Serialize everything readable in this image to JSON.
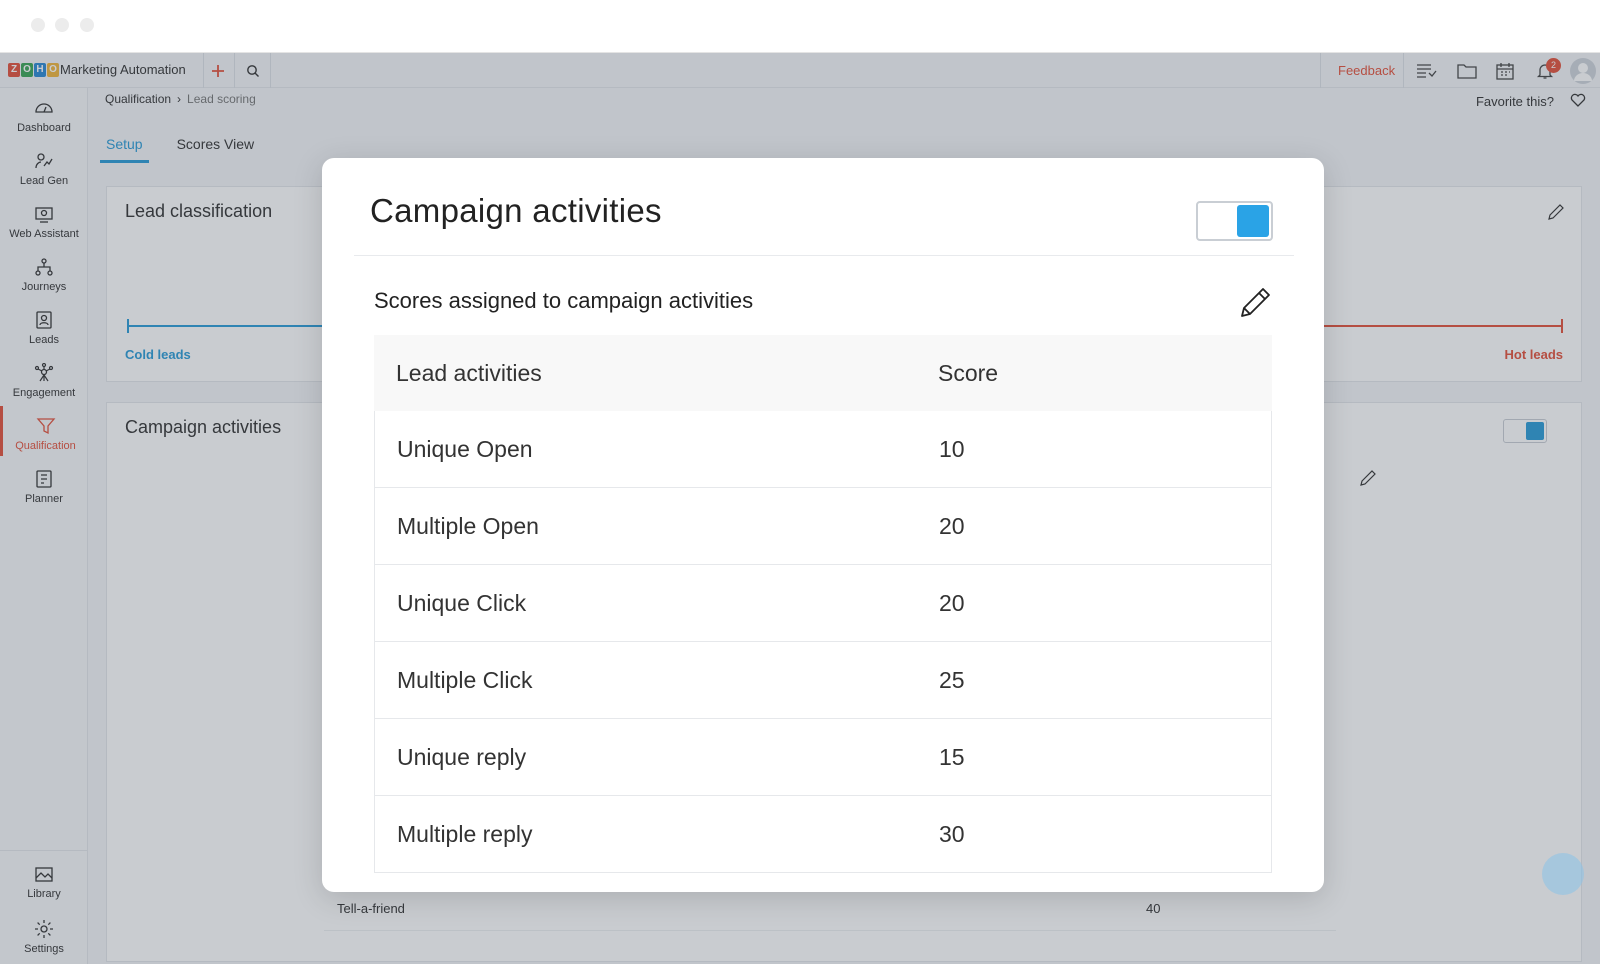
{
  "app": {
    "name": "Marketing Automation",
    "logo_letters": [
      "Z",
      "O",
      "H",
      "O"
    ],
    "logo_colors": [
      "#e4513b",
      "#3aa655",
      "#2a8ad4",
      "#f2b63b"
    ],
    "feedback_label": "Feedback",
    "notification_count": "2"
  },
  "colors": {
    "accent_blue": "#2a9bd7",
    "accent_red": "#e4513b",
    "toggle_on": "#2aa3e6"
  },
  "sidebar": {
    "items": [
      {
        "label": "Dashboard",
        "icon": "dashboard-icon"
      },
      {
        "label": "Lead Gen",
        "icon": "lead-gen-icon"
      },
      {
        "label": "Web Assistant",
        "icon": "web-assistant-icon"
      },
      {
        "label": "Journeys",
        "icon": "journeys-icon"
      },
      {
        "label": "Leads",
        "icon": "leads-icon"
      },
      {
        "label": "Engagement",
        "icon": "engagement-icon"
      },
      {
        "label": "Qualification",
        "icon": "qualification-icon",
        "active": true
      },
      {
        "label": "Planner",
        "icon": "planner-icon"
      }
    ],
    "bottom_items": [
      {
        "label": "Library",
        "icon": "library-icon"
      },
      {
        "label": "Settings",
        "icon": "settings-icon"
      }
    ]
  },
  "breadcrumb": {
    "parent": "Qualification",
    "separator": "›",
    "current": "Lead scoring"
  },
  "favorite_label": "Favorite this?",
  "tabs": [
    {
      "label": "Setup",
      "active": true
    },
    {
      "label": "Scores View",
      "active": false
    }
  ],
  "background": {
    "lead_classification_title": "Lead classification",
    "cold_label": "Cold leads",
    "hot_label": "Hot leads",
    "campaign_title": "Campaign activities",
    "last_row": {
      "activity": "Tell-a-friend",
      "score": "40"
    }
  },
  "modal": {
    "title": "Campaign activities",
    "toggle_on": true,
    "subtitle": "Scores assigned to campaign activities",
    "columns": [
      "Lead activities",
      "Score"
    ],
    "rows": [
      {
        "activity": "Unique Open",
        "score": "10"
      },
      {
        "activity": "Multiple Open",
        "score": "20"
      },
      {
        "activity": "Unique Click",
        "score": "20"
      },
      {
        "activity": "Multiple Click",
        "score": "25"
      },
      {
        "activity": "Unique reply",
        "score": "15"
      },
      {
        "activity": "Multiple reply",
        "score": "30"
      }
    ]
  }
}
